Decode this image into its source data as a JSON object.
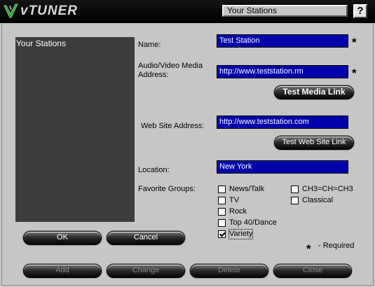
{
  "brand": {
    "logo_text": "vTUNER"
  },
  "header": {
    "title": "Your Stations",
    "help_label": "?"
  },
  "stations_panel": {
    "heading": "Your Stations"
  },
  "form": {
    "name": {
      "label": "Name:",
      "value": "Test Station"
    },
    "media": {
      "label_line1": "Audio/Video Media",
      "label_line2": "Address:",
      "value": "http://www.teststation.rm"
    },
    "test_media_label": "Test Media Link",
    "web": {
      "label": "Web Site Address:",
      "value": "http://www.teststation.com"
    },
    "test_web_label": "Test Web Site Link",
    "location": {
      "label": "Location:",
      "value": "New York"
    },
    "groups_label": "Favorite Groups:",
    "groups": [
      {
        "label": "News/Talk",
        "checked": false
      },
      {
        "label": "TV",
        "checked": false
      },
      {
        "label": "Rock",
        "checked": false
      },
      {
        "label": "Top 40/Dance",
        "checked": false
      },
      {
        "label": "Variety",
        "checked": true
      },
      {
        "label": "CH3=CH=CH3",
        "checked": false
      },
      {
        "label": "Classical",
        "checked": false
      }
    ],
    "required_mark": "*",
    "required_note": "- Required"
  },
  "buttons": {
    "ok": "OK",
    "cancel": "Cancel",
    "add": "Add",
    "change": "Change",
    "delete": "Delete",
    "close": "Close"
  },
  "colors": {
    "field_bg": "#0000aa",
    "panel_bg": "#3c3c3c",
    "window_bg": "#c6c6c6"
  }
}
